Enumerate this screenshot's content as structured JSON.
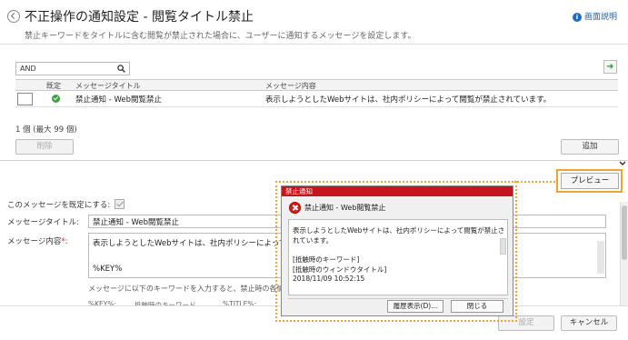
{
  "header": {
    "title": "不正操作の通知設定 - 閲覧タイトル禁止",
    "subtitle": "禁止キーワードをタイトルに含む閲覧が禁止された場合に、ユーザーに通知するメッセージを設定します。",
    "help_label": "画面説明",
    "help_icon": "i"
  },
  "search": {
    "value": "AND",
    "icon": "search-icon"
  },
  "grid": {
    "columns": [
      "既定",
      "メッセージタイトル",
      "メッセージ内容"
    ],
    "rows": [
      {
        "title": "禁止通知 - Web閲覧禁止",
        "content": "表示しようとしたWebサイトは、社内ポリシーによって閲覧が禁止されています。"
      }
    ]
  },
  "count_text": "1 個 (最大 99 個)",
  "buttons": {
    "delete": "削除",
    "add": "追加",
    "preview": "プレビュー",
    "set": "設定",
    "cancel": "キャンセル"
  },
  "form": {
    "default_label": "このメッセージを既定にする:",
    "title_label": "メッセージタイトル:",
    "title_value": "禁止通知 - Web閲覧禁止",
    "content_label": "メッセージ内容",
    "content_required": "*",
    "content_colon": ":",
    "content_line1": "表示しようとしたWebサイトは、社内ポリシーによって閲覧",
    "content_line2": "%KEY%",
    "note": "メッセージに以下のキーワードを入力すると、禁止時の各情報に",
    "kw1": "%KEY%:",
    "kw2": "抵触時のキーワード",
    "kw3": "%TITLE%:"
  },
  "dialog": {
    "titlebar": "禁止通知",
    "heading": "禁止通知 - Web閲覧禁止",
    "body_line1": "表示しようとしたWebサイトは、社内ポリシーによって閲覧が禁止さ",
    "body_line2": "れています。",
    "body_line3": "[抵触時のキーワード]",
    "body_line4": "[抵触時のウィンドウタイトル]",
    "body_line5": "2018/11/09 10:52:15",
    "history_btn": "履歴表示(D)...",
    "close_btn": "閉じる"
  },
  "colors": {
    "accent": "#f0a431",
    "dialog_title": "#c4161c",
    "ok": "#3aa53a",
    "link": "#1a5fb4"
  }
}
